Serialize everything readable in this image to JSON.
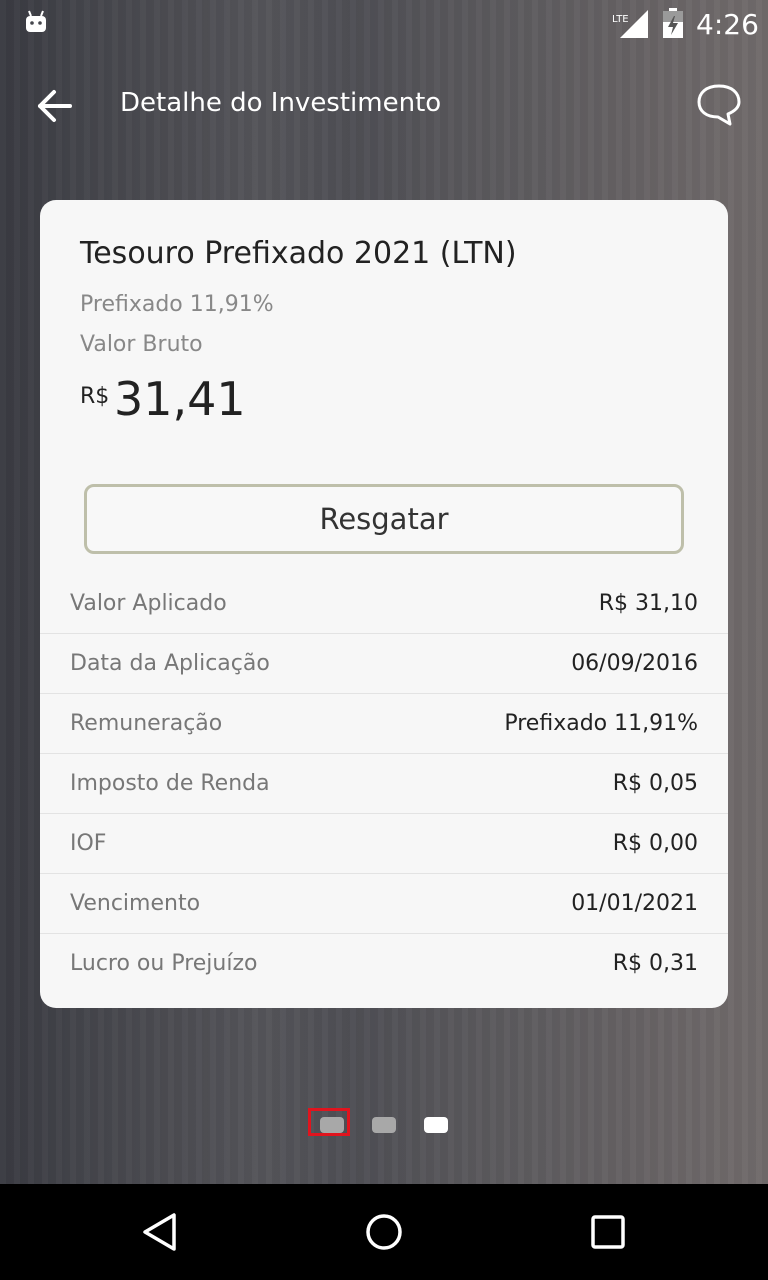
{
  "status_bar": {
    "time": "4:26",
    "network": "LTE",
    "icons": [
      "android-icon",
      "lte-signal-icon",
      "battery-icon"
    ]
  },
  "app_bar": {
    "title": "Detalhe do Investimento",
    "back_icon": "back-arrow-icon",
    "chat_icon": "chat-bubble-icon"
  },
  "investment": {
    "name": "Tesouro Prefixado 2021 (LTN)",
    "subtitle": "Prefixado 11,91%",
    "gross_label": "Valor Bruto",
    "currency": "R$",
    "gross_value": "31,41",
    "redeem_label": "Resgatar"
  },
  "details": [
    {
      "label": "Valor Aplicado",
      "value": "R$ 31,10"
    },
    {
      "label": "Data da Aplicação",
      "value": "06/09/2016"
    },
    {
      "label": "Remuneração",
      "value": "Prefixado 11,91%"
    },
    {
      "label": "Imposto de Renda",
      "value": "R$ 0,05"
    },
    {
      "label": "IOF",
      "value": "R$ 0,00"
    },
    {
      "label": "Vencimento",
      "value": "01/01/2021"
    },
    {
      "label": "Lucro ou Prejuízo",
      "value": "R$ 0,31"
    }
  ],
  "pager": {
    "pages": 3,
    "active_page": 3,
    "highlighted_page": 1,
    "highlight_color": "#e0141e"
  },
  "nav_bar": {
    "icons": [
      "nav-back-icon",
      "nav-home-icon",
      "nav-recents-icon"
    ]
  }
}
